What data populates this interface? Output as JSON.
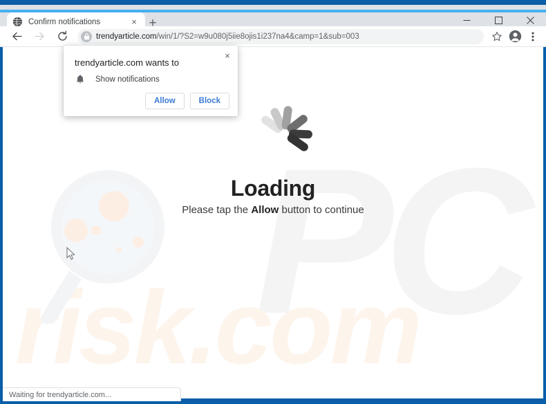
{
  "browser": {
    "tab": {
      "title": "Confirm notifications",
      "favicon_icon": "globe-icon",
      "close_icon": "×"
    },
    "new_tab_icon": "+",
    "window_controls": {
      "minimize": "–",
      "maximize": "□",
      "close": "×"
    },
    "toolbar": {
      "back_icon": "back-arrow-icon",
      "forward_icon": "forward-arrow-icon",
      "reload_icon": "reload-icon",
      "lock_icon": "lock-icon",
      "url_host": "trendyarticle.com",
      "url_path": "/win/1/?S2=w9u080j5iie8ojis1i237na4&camp=1&sub=003",
      "bookmark_icon": "star-icon",
      "profile_icon": "avatar-icon",
      "menu_icon": "three-dot-menu-icon"
    },
    "status_text": "Waiting for trendyarticle.com..."
  },
  "permission_popup": {
    "title": "trendyarticle.com wants to",
    "permission_icon": "bell-icon",
    "permission_label": "Show notifications",
    "allow_label": "Allow",
    "block_label": "Block",
    "close_icon": "×"
  },
  "page": {
    "heading": "Loading",
    "subtext_before": "Please tap the ",
    "subtext_bold": "Allow",
    "subtext_after": " button to continue",
    "spinner_icon": "loading-spinner-icon",
    "watermark_pc": "PC",
    "watermark_risk": "risk.com"
  },
  "colors": {
    "window_frame": "#0b5ea8",
    "titlebar_accent": "#45b0f0",
    "tabbar": "#dee1e6",
    "link_blue": "#3a7bd5",
    "heading": "#222222",
    "watermark_gray": "#f4f4f4",
    "watermark_peach": "#fdf4ec"
  }
}
